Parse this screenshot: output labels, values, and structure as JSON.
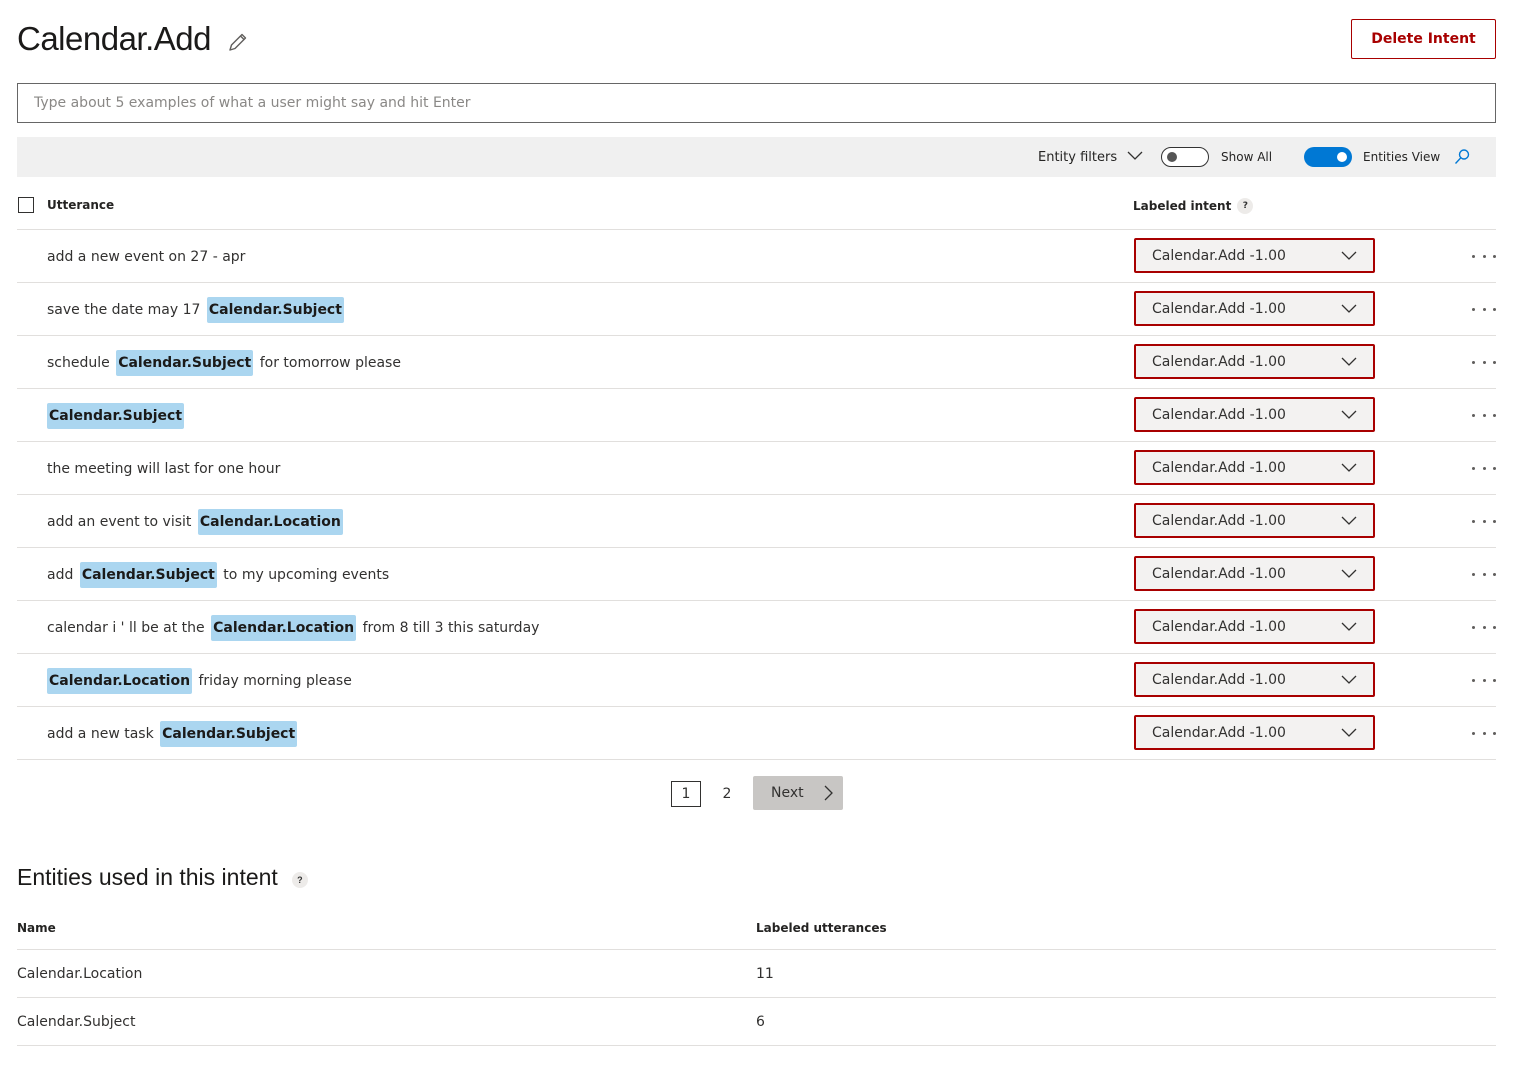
{
  "header": {
    "title": "Calendar.Add",
    "edit_icon": "pencil-icon",
    "delete_button": "Delete Intent"
  },
  "input": {
    "placeholder": "Type about 5 examples of what a user might say and hit Enter",
    "value": ""
  },
  "toolbar": {
    "entity_filters": "Entity filters",
    "show_all": {
      "label": "Show All",
      "on": false
    },
    "entities_view": {
      "label": "Entities View",
      "on": true
    },
    "search_icon": "search-icon"
  },
  "table": {
    "columns": {
      "utterance": "Utterance",
      "labeled_intent": "Labeled intent",
      "help": "?"
    },
    "rows": [
      {
        "segments": [
          {
            "text": "add a new event on 27 - apr"
          }
        ],
        "intent": "Calendar.Add -1.00"
      },
      {
        "segments": [
          {
            "text": "save the date may 17 "
          },
          {
            "entity": "Calendar.Subject"
          }
        ],
        "intent": "Calendar.Add -1.00"
      },
      {
        "segments": [
          {
            "text": "schedule "
          },
          {
            "entity": "Calendar.Subject"
          },
          {
            "text": " for tomorrow please"
          }
        ],
        "intent": "Calendar.Add -1.00"
      },
      {
        "segments": [
          {
            "entity": "Calendar.Subject"
          }
        ],
        "intent": "Calendar.Add -1.00"
      },
      {
        "segments": [
          {
            "text": "the meeting will last for one hour"
          }
        ],
        "intent": "Calendar.Add -1.00"
      },
      {
        "segments": [
          {
            "text": "add an event to visit "
          },
          {
            "entity": "Calendar.Location"
          }
        ],
        "intent": "Calendar.Add -1.00"
      },
      {
        "segments": [
          {
            "text": "add "
          },
          {
            "entity": "Calendar.Subject"
          },
          {
            "text": " to my upcoming events"
          }
        ],
        "intent": "Calendar.Add -1.00"
      },
      {
        "segments": [
          {
            "text": "calendar i ' ll be at the "
          },
          {
            "entity": "Calendar.Location"
          },
          {
            "text": " from 8 till 3 this saturday"
          }
        ],
        "intent": "Calendar.Add -1.00"
      },
      {
        "segments": [
          {
            "entity": "Calendar.Location"
          },
          {
            "text": " friday morning please"
          }
        ],
        "intent": "Calendar.Add -1.00"
      },
      {
        "segments": [
          {
            "text": "add a new task "
          },
          {
            "entity": "Calendar.Subject"
          }
        ],
        "intent": "Calendar.Add -1.00"
      }
    ]
  },
  "pagination": {
    "pages": [
      "1",
      "2"
    ],
    "current": "1",
    "next": "Next"
  },
  "entities_section": {
    "title": "Entities used in this intent",
    "help": "?",
    "columns": {
      "name": "Name",
      "labeled": "Labeled utterances"
    },
    "rows": [
      {
        "name": "Calendar.Location",
        "count": "11"
      },
      {
        "name": "Calendar.Subject",
        "count": "6"
      }
    ]
  },
  "colors": {
    "danger": "#a80000",
    "accent": "#0078d4",
    "entity_highlight": "#abd6f0",
    "toolbar_bg": "#f0f0f0"
  }
}
